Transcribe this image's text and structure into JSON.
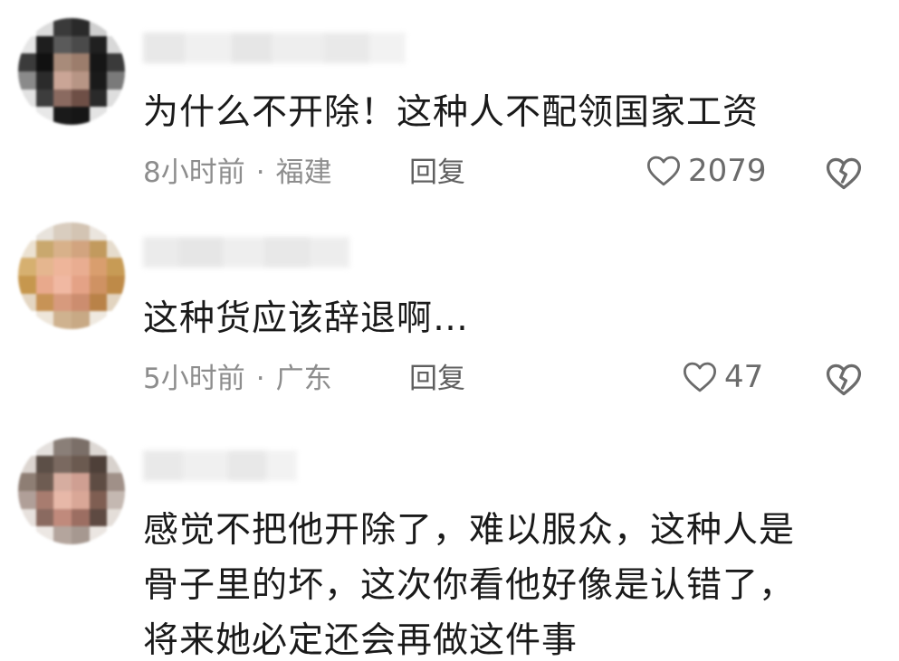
{
  "comments": [
    {
      "text": "为什么不开除！这种人不配领国家工资",
      "time": "8小时前",
      "location": "福建",
      "separator": "·",
      "reply_label": "回复",
      "likes": "2079"
    },
    {
      "text": "这种货应该辞退啊…",
      "time": "5小时前",
      "location": "广东",
      "separator": "·",
      "reply_label": "回复",
      "likes": "47"
    },
    {
      "text": "感觉不把他开除了，难以服众，这种人是\n骨子里的坏，这次你看他好像是认错了，\n将来她必定还会再做这件事"
    }
  ],
  "icons": {
    "like": "heart-outline-icon",
    "dislike": "broken-heart-icon"
  },
  "colors": {
    "text": "#1a1a1a",
    "meta": "#8d8d8d",
    "reply": "#5f5f5f",
    "icon": "#6b6b6b"
  }
}
